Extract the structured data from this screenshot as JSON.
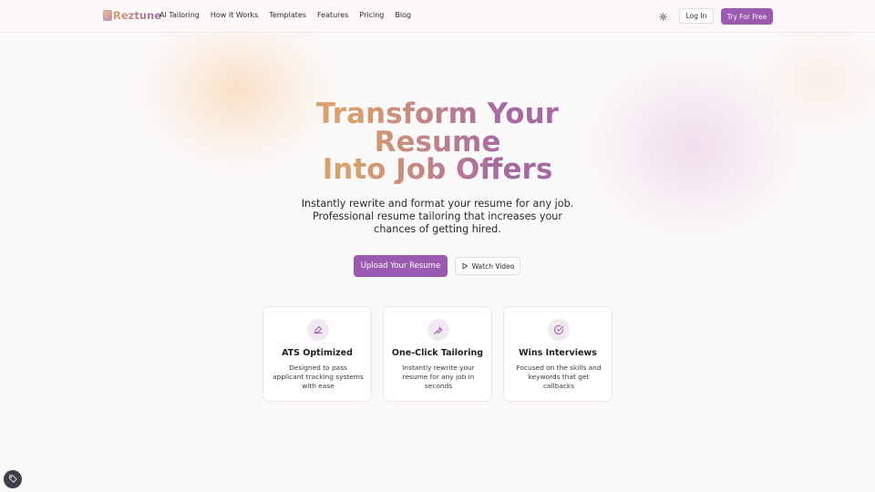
{
  "brand": {
    "name": "Reztune",
    "accent": "#9c59b0"
  },
  "nav": {
    "items": [
      "AI Tailoring",
      "How It Works",
      "Templates",
      "Features",
      "Pricing",
      "Blog"
    ]
  },
  "header": {
    "theme_icon": "sun-icon",
    "login_label": "Log In",
    "try_label": "Try For Free"
  },
  "hero": {
    "title_line1": "Transform Your",
    "title_line2": "Resume",
    "title_line3": "Into Job Offers",
    "subtitle": "Instantly rewrite and format your resume for any job. Professional resume tailoring that increases your chances of getting hired.",
    "upload_label": "Upload Your Resume",
    "watch_label": "Watch Video"
  },
  "features": [
    {
      "icon": "signature-icon",
      "title": "ATS Optimized",
      "desc": "Designed to pass applicant tracking systems with ease"
    },
    {
      "icon": "wrench-icon",
      "title": "One-Click Tailoring",
      "desc": "Instantly rewrite your resume for any job in seconds"
    },
    {
      "icon": "check-circle-icon",
      "title": "Wins Interviews",
      "desc": "Focused on the skills and keywords that get callbacks"
    }
  ],
  "help": {
    "icon": "tag-icon"
  }
}
